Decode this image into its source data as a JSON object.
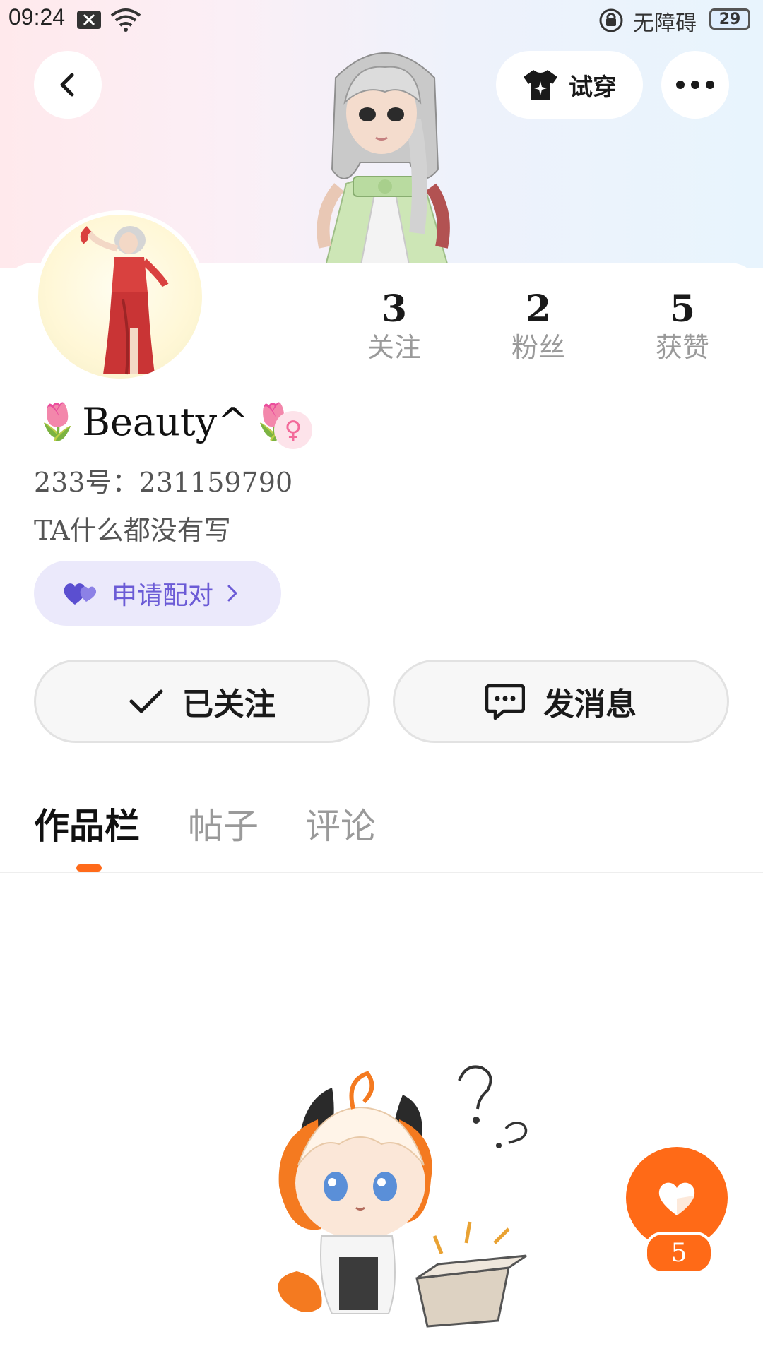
{
  "status_bar": {
    "time": "09:24",
    "accessibility_label": "无障碍",
    "battery": "29"
  },
  "header": {
    "try_on_label": "试穿"
  },
  "profile": {
    "name": "Beauty^",
    "name_emoji": "🌷",
    "gender_symbol": "♀",
    "user_id": "233号：231159790",
    "bio": "TA什么都没有写"
  },
  "stats": [
    {
      "value": "3",
      "label": "关注"
    },
    {
      "value": "2",
      "label": "粉丝"
    },
    {
      "value": "5",
      "label": "获赞"
    }
  ],
  "pair_button": {
    "label": "申请配对"
  },
  "actions": {
    "follow_label": "已关注",
    "message_label": "发消息"
  },
  "tabs": [
    {
      "label": "作品栏",
      "active": true
    },
    {
      "label": "帖子",
      "active": false
    },
    {
      "label": "评论",
      "active": false
    }
  ],
  "like_fab": {
    "count": "5"
  },
  "colors": {
    "accent": "#ff6a17",
    "pair_text": "#6b5bd6",
    "pair_bg": "#ebe9fb",
    "gender": "#f36a9a"
  }
}
